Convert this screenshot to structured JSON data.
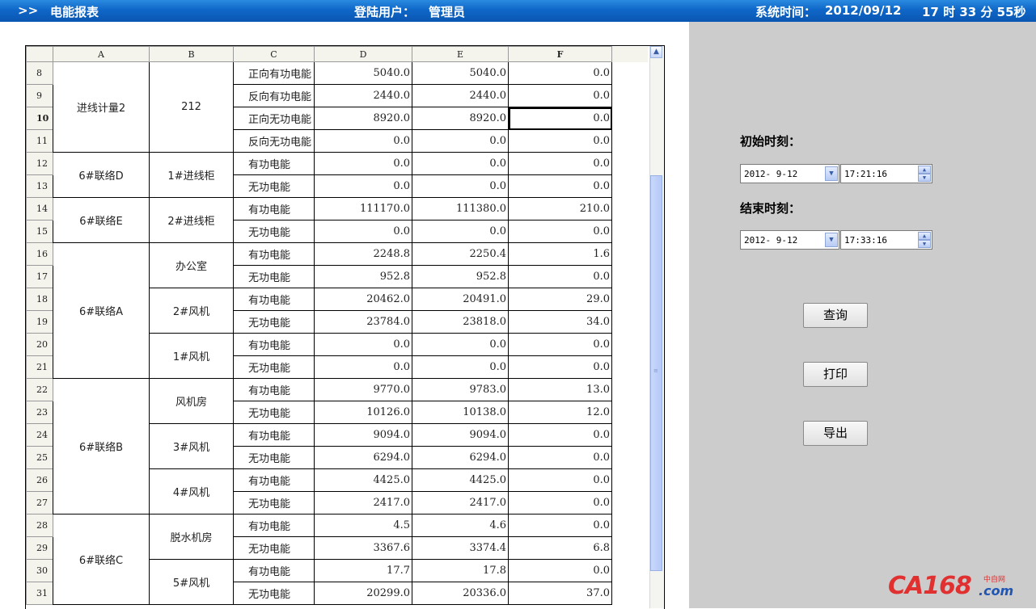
{
  "header": {
    "arrow": ">>",
    "title": "电能报表",
    "user_label": "登陆用户：",
    "user": "管理员",
    "time_label": "系统时间：",
    "date": "2012/09/12",
    "clock": "17 时 33 分 55秒"
  },
  "sheet": {
    "columns": [
      "A",
      "B",
      "C",
      "D",
      "E",
      "F"
    ],
    "active_column": "F",
    "active_row": "10",
    "rows": [
      {
        "n": "8",
        "c": "正向有功电能",
        "d": "5040.0",
        "e": "5040.0",
        "f": "0.0"
      },
      {
        "n": "9",
        "c": "反向有功电能",
        "d": "2440.0",
        "e": "2440.0",
        "f": "0.0"
      },
      {
        "n": "10",
        "c": "正向无功电能",
        "d": "8920.0",
        "e": "8920.0",
        "f": "0.0"
      },
      {
        "n": "11",
        "c": "反向无功电能",
        "d": "0.0",
        "e": "0.0",
        "f": "0.0"
      },
      {
        "n": "12",
        "c": "有功电能",
        "d": "0.0",
        "e": "0.0",
        "f": "0.0"
      },
      {
        "n": "13",
        "c": "无功电能",
        "d": "0.0",
        "e": "0.0",
        "f": "0.0"
      },
      {
        "n": "14",
        "c": "有功电能",
        "d": "111170.0",
        "e": "111380.0",
        "f": "210.0"
      },
      {
        "n": "15",
        "c": "无功电能",
        "d": "0.0",
        "e": "0.0",
        "f": "0.0"
      },
      {
        "n": "16",
        "c": "有功电能",
        "d": "2248.8",
        "e": "2250.4",
        "f": "1.6"
      },
      {
        "n": "17",
        "c": "无功电能",
        "d": "952.8",
        "e": "952.8",
        "f": "0.0"
      },
      {
        "n": "18",
        "c": "有功电能",
        "d": "20462.0",
        "e": "20491.0",
        "f": "29.0"
      },
      {
        "n": "19",
        "c": "无功电能",
        "d": "23784.0",
        "e": "23818.0",
        "f": "34.0"
      },
      {
        "n": "20",
        "c": "有功电能",
        "d": "0.0",
        "e": "0.0",
        "f": "0.0"
      },
      {
        "n": "21",
        "c": "无功电能",
        "d": "0.0",
        "e": "0.0",
        "f": "0.0"
      },
      {
        "n": "22",
        "c": "有功电能",
        "d": "9770.0",
        "e": "9783.0",
        "f": "13.0"
      },
      {
        "n": "23",
        "c": "无功电能",
        "d": "10126.0",
        "e": "10138.0",
        "f": "12.0"
      },
      {
        "n": "24",
        "c": "有功电能",
        "d": "9094.0",
        "e": "9094.0",
        "f": "0.0"
      },
      {
        "n": "25",
        "c": "无功电能",
        "d": "6294.0",
        "e": "6294.0",
        "f": "0.0"
      },
      {
        "n": "26",
        "c": "有功电能",
        "d": "4425.0",
        "e": "4425.0",
        "f": "0.0"
      },
      {
        "n": "27",
        "c": "无功电能",
        "d": "2417.0",
        "e": "2417.0",
        "f": "0.0"
      },
      {
        "n": "28",
        "c": "有功电能",
        "d": "4.5",
        "e": "4.6",
        "f": "0.0"
      },
      {
        "n": "29",
        "c": "无功电能",
        "d": "3367.6",
        "e": "3374.4",
        "f": "6.8"
      },
      {
        "n": "30",
        "c": "有功电能",
        "d": "17.7",
        "e": "17.8",
        "f": "0.0"
      },
      {
        "n": "31",
        "c": "无功电能",
        "d": "20299.0",
        "e": "20336.0",
        "f": "37.0"
      }
    ],
    "group_a": [
      {
        "label": "进线计量2",
        "start": 0,
        "span": 4
      },
      {
        "label": "6#联络D",
        "start": 4,
        "span": 2
      },
      {
        "label": "6#联络E",
        "start": 6,
        "span": 2
      },
      {
        "label": "6#联络A",
        "start": 8,
        "span": 6
      },
      {
        "label": "6#联络B",
        "start": 14,
        "span": 6
      },
      {
        "label": "6#联络C",
        "start": 20,
        "span": 4
      }
    ],
    "group_b": [
      {
        "label": "212",
        "start": 0,
        "span": 4
      },
      {
        "label": "1#进线柜",
        "start": 4,
        "span": 2
      },
      {
        "label": "2#进线柜",
        "start": 6,
        "span": 2
      },
      {
        "label": "办公室",
        "start": 8,
        "span": 2
      },
      {
        "label": "2#风机",
        "start": 10,
        "span": 2
      },
      {
        "label": "1#风机",
        "start": 12,
        "span": 2
      },
      {
        "label": "风机房",
        "start": 14,
        "span": 2
      },
      {
        "label": "3#风机",
        "start": 16,
        "span": 2
      },
      {
        "label": "4#风机",
        "start": 18,
        "span": 2
      },
      {
        "label": "脱水机房",
        "start": 20,
        "span": 2
      },
      {
        "label": "5#风机",
        "start": 22,
        "span": 2
      }
    ]
  },
  "query": {
    "start_label": "初始时刻：",
    "start_date": "2012- 9-12",
    "start_time": "17:21:16",
    "end_label": "结束时刻：",
    "end_date": "2012- 9-12",
    "end_time": "17:33:16",
    "buttons": {
      "query": "查询",
      "print": "打印",
      "export": "导出"
    }
  },
  "watermark": {
    "brand": "CA168",
    "cn": "中自网",
    "suffix": ".com"
  }
}
